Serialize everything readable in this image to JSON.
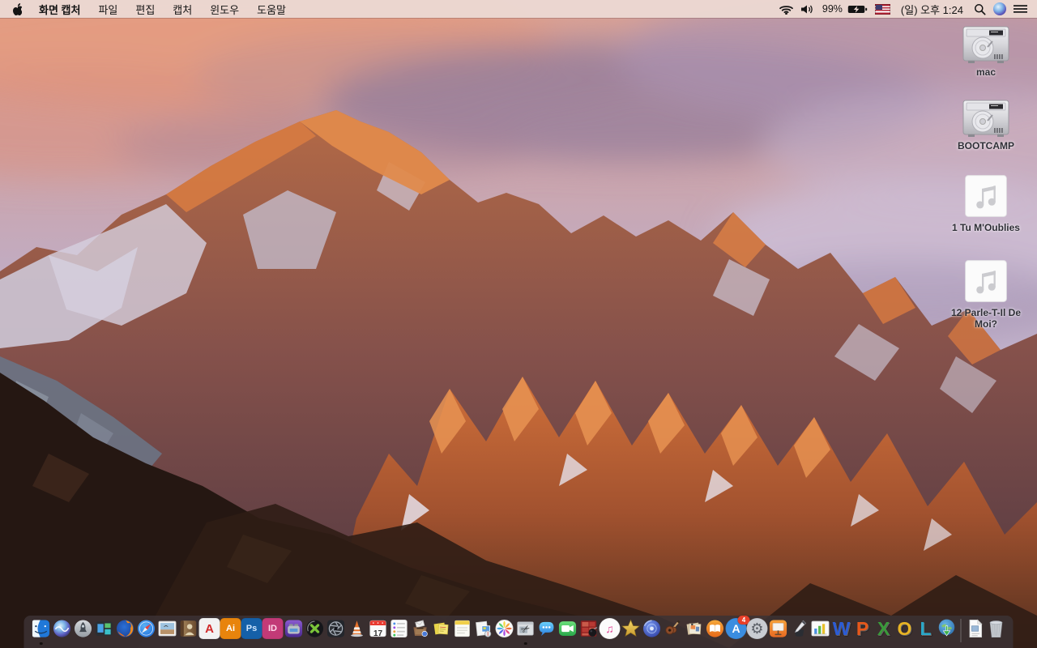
{
  "menu_bar": {
    "apple_menu_icon": "apple-logo",
    "active_app": "화면 캡처",
    "menus": [
      "파일",
      "편집",
      "캡처",
      "윈도우",
      "도움말"
    ],
    "status": {
      "wifi_icon": "wifi-icon",
      "volume_icon": "volume-icon",
      "battery_percent": "99%",
      "battery_state": "charging",
      "input_source_flag": "us-flag",
      "clock": "(일) 오후 1:24",
      "spotlight_icon": "search-icon",
      "siri_icon": "siri-icon",
      "notification_center_icon": "list-icon"
    }
  },
  "desktop": {
    "label_color": "#2e2e36",
    "icons": [
      {
        "label": "mac",
        "type": "drive"
      },
      {
        "label": "BOOTCAMP",
        "type": "drive"
      },
      {
        "label": "1 Tu M'Oublies",
        "type": "audio"
      },
      {
        "label": "12 Parle-T-Il De Moi?",
        "type": "audio"
      }
    ]
  },
  "dock": {
    "bg": "rgba(60,50,52,0.84)",
    "items": [
      {
        "name": "finder",
        "sym": "finder",
        "running": true
      },
      {
        "name": "siri",
        "sym": "siri"
      },
      {
        "name": "launchpad",
        "sym": "launchpad"
      },
      {
        "name": "mission-control",
        "sym": "mission"
      },
      {
        "name": "firefox",
        "sym": "firefox"
      },
      {
        "name": "safari",
        "sym": "safari"
      },
      {
        "name": "preview",
        "sym": "preview"
      },
      {
        "name": "contacts",
        "sym": "contacts"
      },
      {
        "name": "acrobat-reader",
        "sq": "#f2f2f2",
        "glyph": "A",
        "glyphColor": "#d02b2b",
        "glyphSize": 15,
        "glyphBold": true
      },
      {
        "name": "illustrator",
        "sq": "#e8840c",
        "glyph": "Ai",
        "glyphColor": "#ffffff",
        "glyphSize": 11,
        "glyphBold": true
      },
      {
        "name": "photoshop",
        "sq": "#1560a8",
        "glyph": "Ps",
        "glyphColor": "#cfe6ff",
        "glyphSize": 11,
        "glyphBold": true
      },
      {
        "name": "indesign",
        "sq": "#c23a77",
        "glyph": "ID",
        "glyphColor": "#ffd8ea",
        "glyphSize": 11,
        "glyphBold": true
      },
      {
        "name": "toast",
        "sym": "toast"
      },
      {
        "name": "divx-player",
        "sym": "divx"
      },
      {
        "name": "aperture",
        "sym": "aperture"
      },
      {
        "name": "vlc",
        "sym": "vlc"
      },
      {
        "name": "calendar",
        "sym": "calendar",
        "glyph": "17",
        "glyphColor": "#333333",
        "glyphSize": 10,
        "glyphBold": true,
        "glyphDy": 7
      },
      {
        "name": "reminders",
        "sym": "reminders"
      },
      {
        "name": "mail-drop-box",
        "sym": "mailbox"
      },
      {
        "name": "stickies",
        "sym": "stickies"
      },
      {
        "name": "notes",
        "sym": "notes"
      },
      {
        "name": "stationery",
        "sym": "stationery"
      },
      {
        "name": "photos",
        "sym": "photos"
      },
      {
        "name": "grab-screen-capture",
        "sym": "grab",
        "glyph": "✂",
        "glyphColor": "#3a3a3a",
        "glyphSize": 13,
        "glyphRotate": -30,
        "running": true
      },
      {
        "name": "messages",
        "sym": "messages"
      },
      {
        "name": "facetime",
        "sym": "facetime"
      },
      {
        "name": "photo-contact-sheet",
        "sym": "filmgrid"
      },
      {
        "name": "itunes",
        "sq": "#fbfbfb",
        "round": true,
        "glyph": "♫",
        "glyphColor": "#e04a98",
        "glyphSize": 14
      },
      {
        "name": "imovie",
        "sym": "imovie"
      },
      {
        "name": "idvd",
        "sym": "idvd"
      },
      {
        "name": "garageband",
        "sym": "garageband"
      },
      {
        "name": "scrapbook",
        "sym": "scrapbook"
      },
      {
        "name": "ibooks",
        "sym": "ibooks"
      },
      {
        "name": "app-store",
        "sq": "#3a8de0",
        "round": true,
        "glyph": "A",
        "glyphColor": "#ffffff",
        "glyphSize": 14,
        "glyphBold": true,
        "badge": "4"
      },
      {
        "name": "system-preferences",
        "sq": "#c9ccd2",
        "round": true,
        "glyph": "⚙",
        "glyphColor": "#5a5e66",
        "glyphSize": 18
      },
      {
        "name": "keynote",
        "sym": "keynote"
      },
      {
        "name": "pages",
        "sym": "pages"
      },
      {
        "name": "numbers",
        "sym": "numbers"
      },
      {
        "name": "word",
        "glyph": "W",
        "glyphColor": "#2b5cd6",
        "glyphSize": 23,
        "glyphBold": true,
        "letter3d": true
      },
      {
        "name": "powerpoint",
        "glyph": "P",
        "glyphColor": "#e8581a",
        "glyphSize": 23,
        "glyphBold": true,
        "letter3d": true
      },
      {
        "name": "excel",
        "glyph": "X",
        "glyphColor": "#3a9a3a",
        "glyphSize": 23,
        "glyphBold": true,
        "letter3d": true
      },
      {
        "name": "outlook",
        "glyph": "O",
        "glyphColor": "#e8b424",
        "glyphSize": 23,
        "glyphBold": true,
        "letter3d": true
      },
      {
        "name": "lync",
        "glyph": "L",
        "glyphColor": "#2aa8c9",
        "glyphSize": 23,
        "glyphBold": true,
        "letter3d": true
      },
      {
        "name": "download-globe",
        "sym": "globe"
      },
      {
        "sep": true
      },
      {
        "name": "document",
        "sym": "docfile"
      },
      {
        "name": "trash",
        "sym": "trash"
      }
    ]
  }
}
